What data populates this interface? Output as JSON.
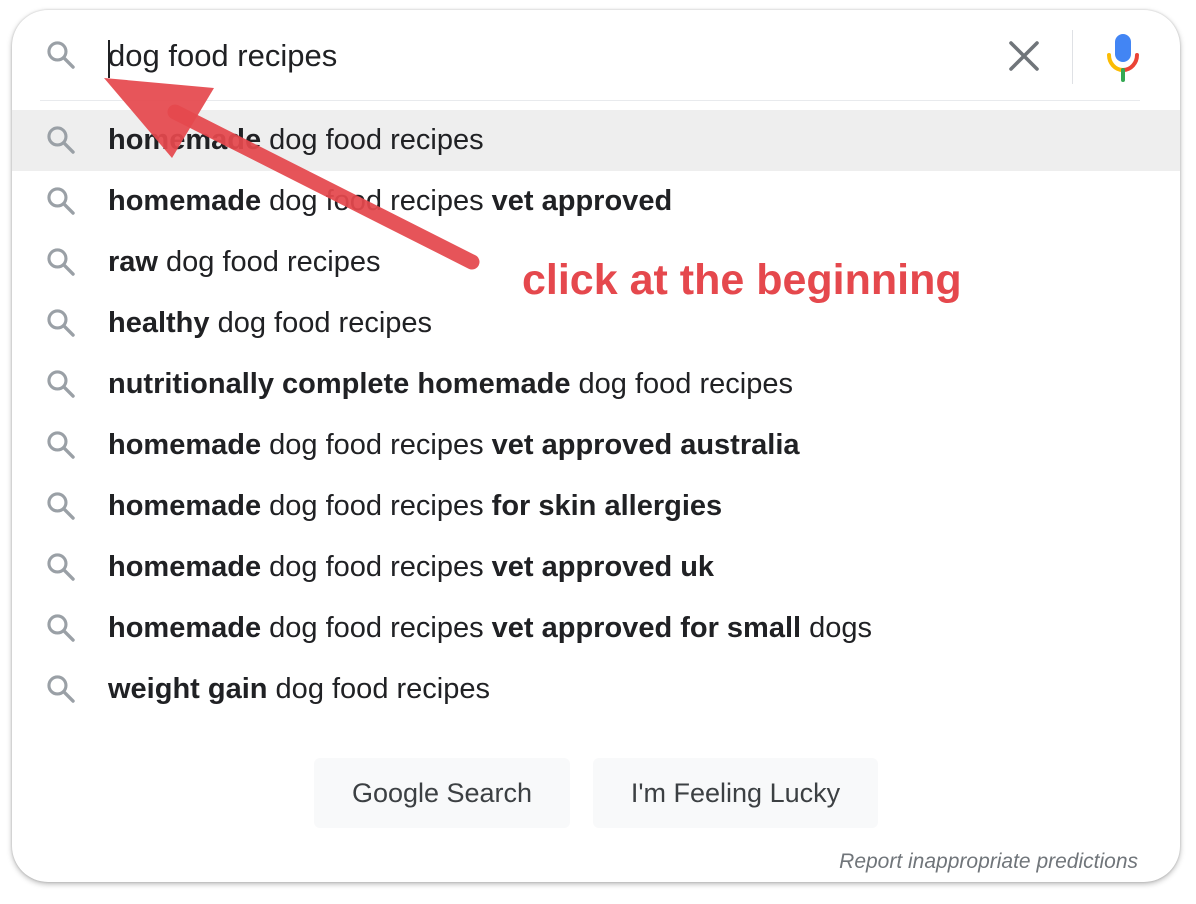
{
  "search": {
    "query": "dog food recipes",
    "search_icon": "search-icon",
    "clear_icon": "close-icon",
    "mic_icon": "microphone-icon"
  },
  "suggestions": [
    {
      "parts": [
        {
          "text": "homemade",
          "bold": true
        },
        {
          "text": " dog food recipes",
          "bold": false
        }
      ]
    },
    {
      "parts": [
        {
          "text": "homemade",
          "bold": true
        },
        {
          "text": " dog food recipes ",
          "bold": false
        },
        {
          "text": "vet approved",
          "bold": true
        }
      ]
    },
    {
      "parts": [
        {
          "text": "raw",
          "bold": true
        },
        {
          "text": " dog food recipes",
          "bold": false
        }
      ]
    },
    {
      "parts": [
        {
          "text": "healthy",
          "bold": true
        },
        {
          "text": " dog food recipes",
          "bold": false
        }
      ]
    },
    {
      "parts": [
        {
          "text": "nutritionally complete homemade",
          "bold": true
        },
        {
          "text": " dog food recipes",
          "bold": false
        }
      ]
    },
    {
      "parts": [
        {
          "text": "homemade",
          "bold": true
        },
        {
          "text": " dog food recipes ",
          "bold": false
        },
        {
          "text": "vet approved australia",
          "bold": true
        }
      ]
    },
    {
      "parts": [
        {
          "text": "homemade",
          "bold": true
        },
        {
          "text": " dog food recipes ",
          "bold": false
        },
        {
          "text": "for skin allergies",
          "bold": true
        }
      ]
    },
    {
      "parts": [
        {
          "text": "homemade",
          "bold": true
        },
        {
          "text": " dog food recipes ",
          "bold": false
        },
        {
          "text": "vet approved uk",
          "bold": true
        }
      ]
    },
    {
      "parts": [
        {
          "text": "homemade",
          "bold": true
        },
        {
          "text": " dog food recipes ",
          "bold": false
        },
        {
          "text": "vet approved for small",
          "bold": true
        },
        {
          "text": " dogs",
          "bold": false
        }
      ]
    },
    {
      "parts": [
        {
          "text": "weight gain",
          "bold": true
        },
        {
          "text": " dog food recipes",
          "bold": false
        }
      ]
    }
  ],
  "buttons": {
    "google_search": "Google Search",
    "feeling_lucky": "I'm Feeling Lucky"
  },
  "report_link": "Report inappropriate predictions",
  "annotation": {
    "text": "click at the beginning",
    "color": "#e5484d"
  },
  "colors": {
    "mic_blue": "#4285f4",
    "mic_red": "#ea4335",
    "mic_yellow": "#fbbc04",
    "mic_green": "#34a853",
    "icon_gray": "#9aa0a6"
  }
}
